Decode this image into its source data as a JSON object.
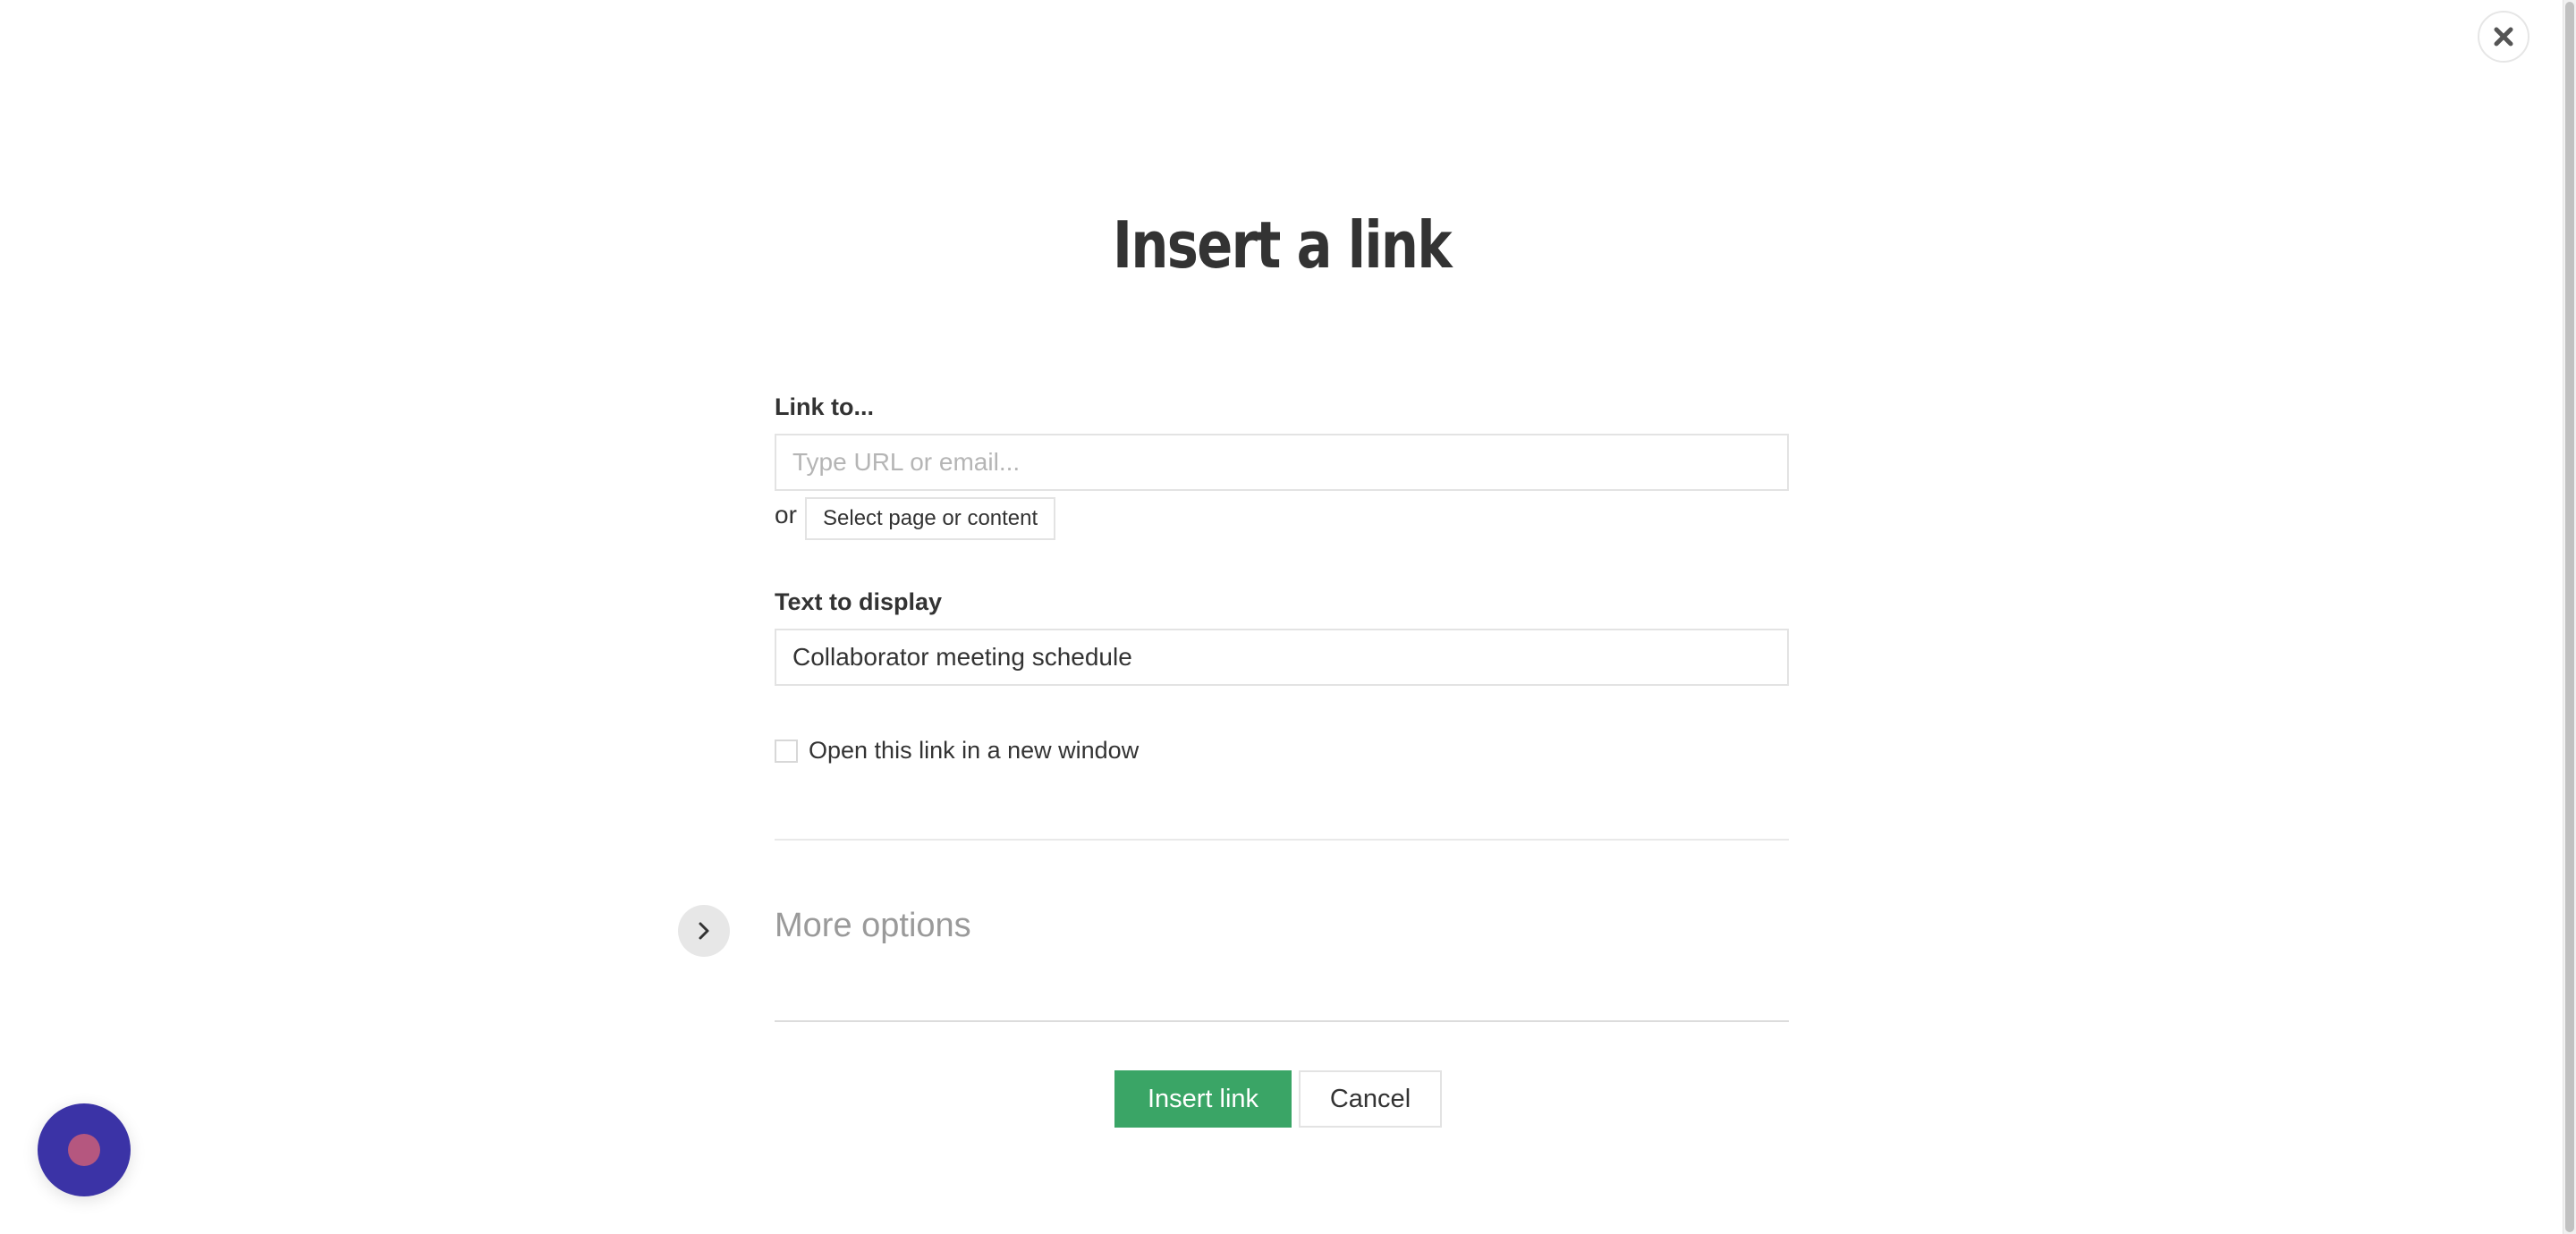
{
  "dialog": {
    "title": "Insert a link"
  },
  "link_to": {
    "label": "Link to...",
    "placeholder": "Type URL or email...",
    "value": "",
    "or_text": "or",
    "select_button_label": "Select page or content"
  },
  "text_to_display": {
    "label": "Text to display",
    "value": "Collaborator meeting schedule"
  },
  "new_window": {
    "label": "Open this link in a new window",
    "checked": false
  },
  "more_options": {
    "label": "More options",
    "icon": "chevron-right-icon"
  },
  "actions": {
    "insert_label": "Insert link",
    "cancel_label": "Cancel"
  },
  "icons": {
    "close": "close-icon",
    "chat": "chat-launcher-icon"
  },
  "colors": {
    "primary_button": "#3aa566",
    "chat_bubble": "#3b33a6",
    "chat_dot": "#b5577f",
    "text": "#333333",
    "muted": "#9a9a9a"
  }
}
